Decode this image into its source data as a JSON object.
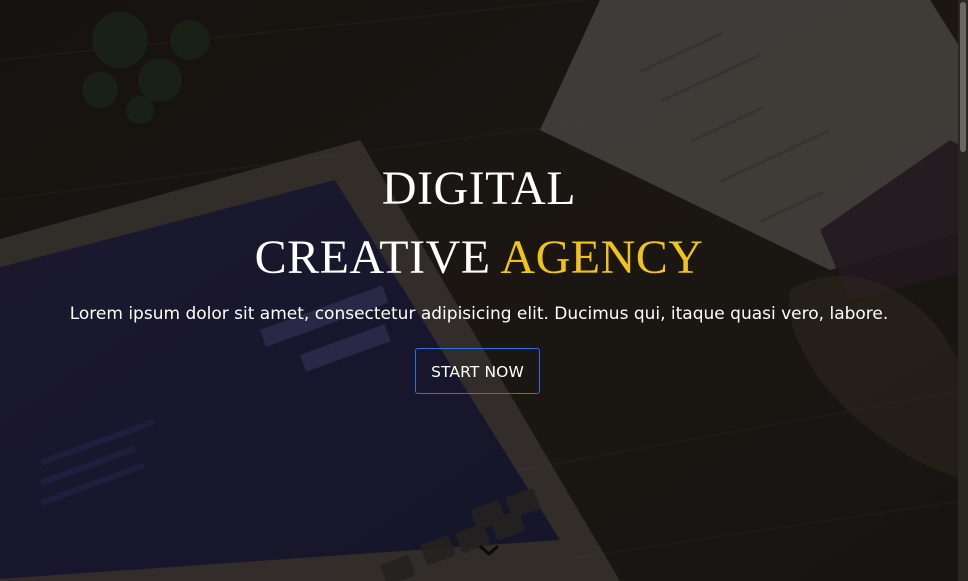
{
  "hero": {
    "title_line_1": "DIGITAL",
    "title_line_2_main": "CREATIVE ",
    "title_line_2_accent": "AGENCY",
    "subtitle": "Lorem ipsum dolor sit amet, consectetur adipisicing elit. Ducimus qui, itaque quasi vero, labore.",
    "cta_label": "START NOW",
    "scroll_icon": "chevron-down-icon"
  },
  "colors": {
    "accent": "#f0c319",
    "button_border": "#2f6fe0",
    "text": "#ffffff"
  }
}
